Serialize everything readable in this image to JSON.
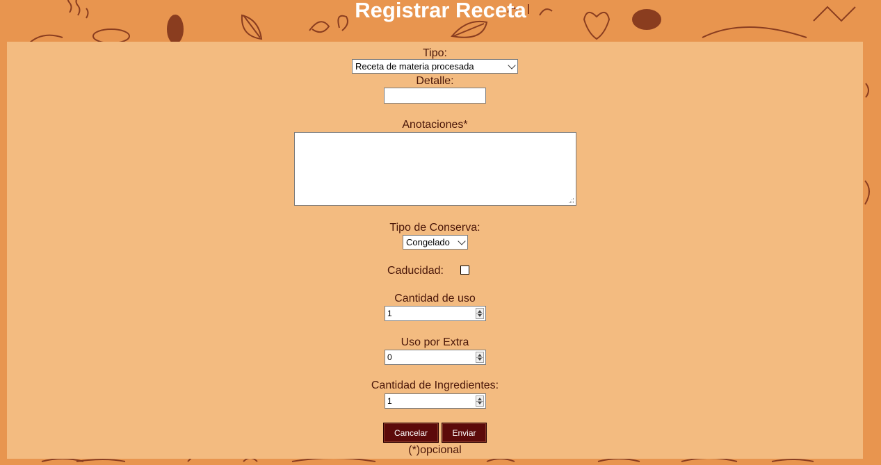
{
  "page": {
    "title": "Registrar Receta"
  },
  "form": {
    "tipo": {
      "label": "Tipo:",
      "selected": "Receta de materia procesada"
    },
    "detalle": {
      "label": "Detalle:",
      "value": ""
    },
    "anotaciones": {
      "label": "Anotaciones*",
      "value": ""
    },
    "tipo_conserva": {
      "label": "Tipo de Conserva:",
      "selected": "Congelado"
    },
    "caducidad": {
      "label": "Caducidad:",
      "checked": false
    },
    "cantidad_uso": {
      "label": "Cantidad de uso",
      "value": "1"
    },
    "uso_extra": {
      "label": "Uso por Extra",
      "value": "0"
    },
    "cantidad_ingredientes": {
      "label": "Cantidad de Ingredientes:",
      "value": "1"
    },
    "buttons": {
      "cancel": "Cancelar",
      "submit": "Enviar"
    },
    "footnote": "(*)opcional"
  },
  "colors": {
    "background": "#e8954f",
    "panel": "#f3bb80",
    "label_text": "#4a1608",
    "button": "#5c0a0a"
  }
}
